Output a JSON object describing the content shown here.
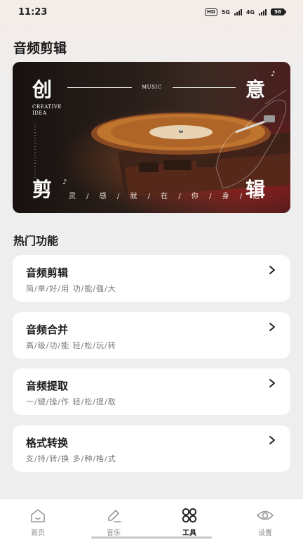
{
  "status": {
    "time": "11:23",
    "hd": "HD",
    "net1": "5G",
    "net2": "4G",
    "battery": "58"
  },
  "page": {
    "title": "音频剪辑"
  },
  "banner": {
    "char_tl": "创",
    "char_tr": "意",
    "char_bl": "剪",
    "char_br": "辑",
    "music": "MUSIC",
    "creative": "CREATIVE",
    "idea": "IDEA",
    "slogan": "灵 / 感 / 就 / 在 / 你 / 身 / 边"
  },
  "hot": {
    "title": "热门功能"
  },
  "features": [
    {
      "title": "音频剪辑",
      "subtitle": "简/单/好/用 功/能/强/大"
    },
    {
      "title": "音频合并",
      "subtitle": "高/级/功/能 轻/松/玩/转"
    },
    {
      "title": "音频提取",
      "subtitle": "一/键/操/作 轻/松/提/取"
    },
    {
      "title": "格式转换",
      "subtitle": "支/持/转/换 多/种/格/式"
    }
  ],
  "tabs": [
    {
      "label": "首页",
      "icon": "home-icon",
      "active": false
    },
    {
      "label": "音乐",
      "icon": "edit-music-icon",
      "active": false
    },
    {
      "label": "工具",
      "icon": "grid-tools-icon",
      "active": true
    },
    {
      "label": "设置",
      "icon": "eye-settings-icon",
      "active": false
    }
  ],
  "colors": {
    "background": "#eeeeee",
    "card": "#ffffff",
    "banner_red": "#b41e1e",
    "text_primary": "#1a1a1a",
    "text_secondary": "#777777"
  }
}
